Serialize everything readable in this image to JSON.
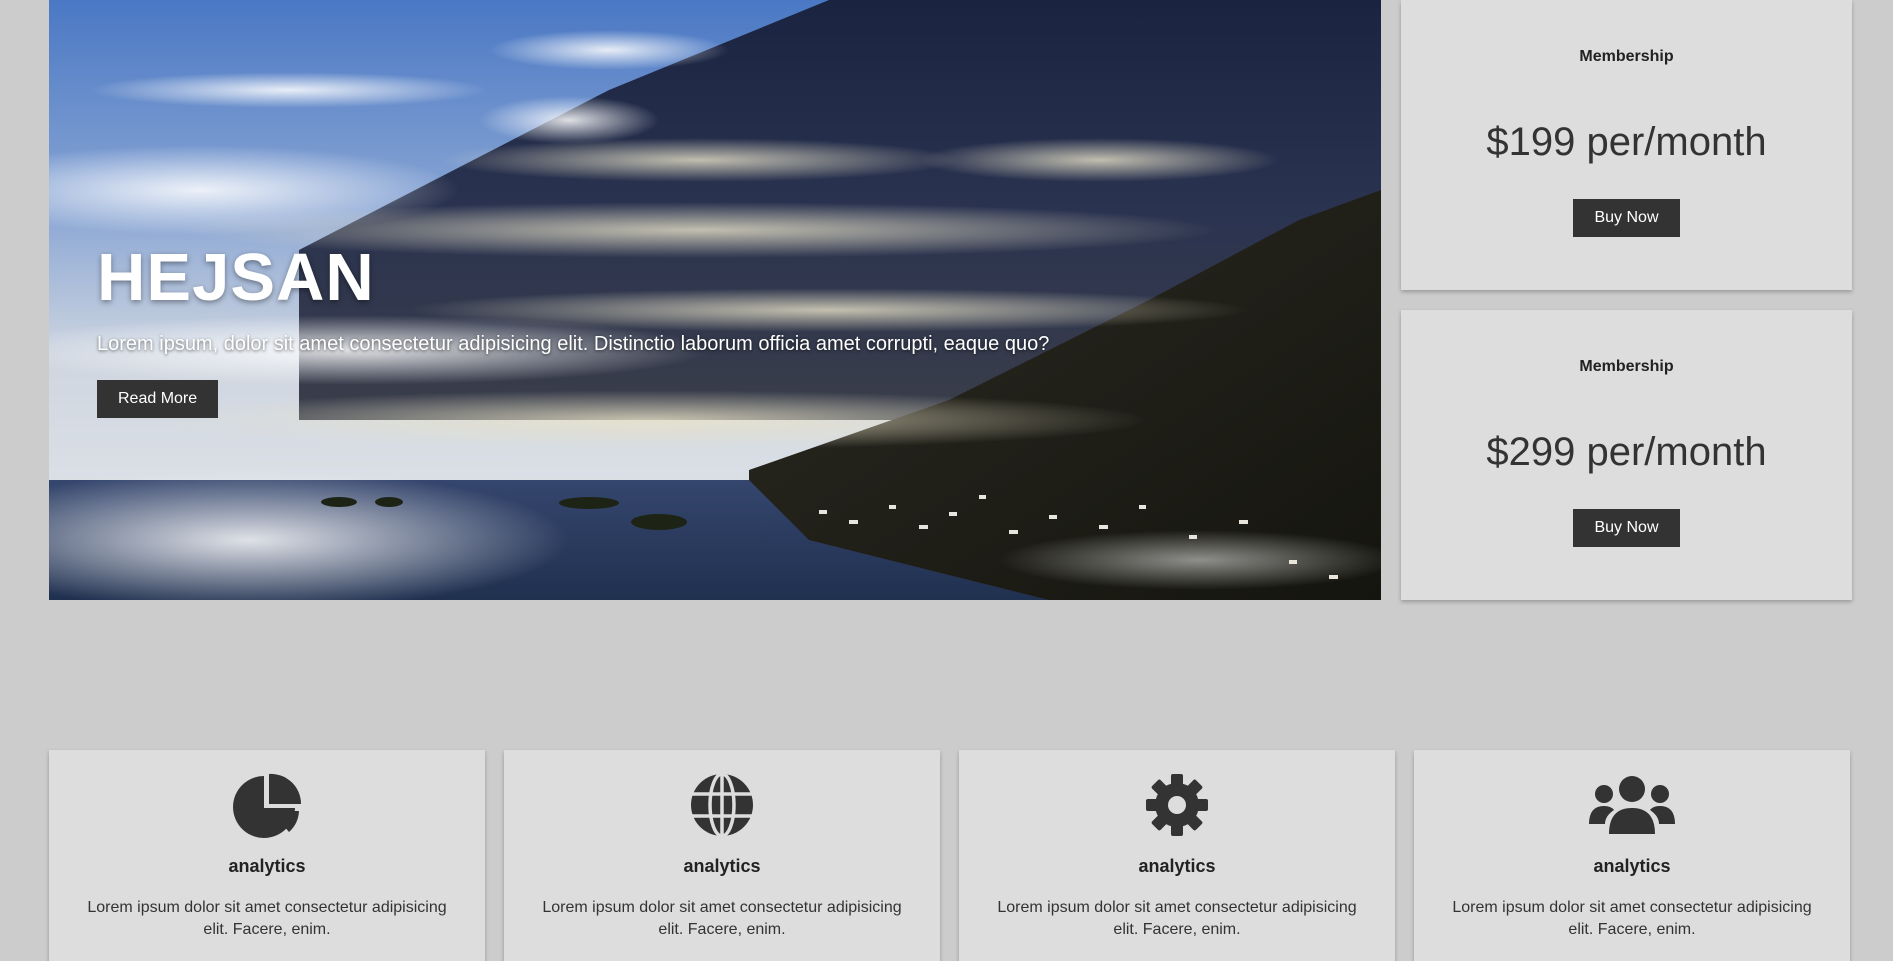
{
  "hero": {
    "title": "HEJSAN",
    "text": "Lorem ipsum, dolor sit amet consectetur adipisicing elit. Distinctio laborum officia amet corrupti, eaque quo?",
    "button": "Read More"
  },
  "plans": [
    {
      "title": "Membership",
      "price": "$199 per/month",
      "button": "Buy Now"
    },
    {
      "title": "Membership",
      "price": "$299 per/month",
      "button": "Buy Now"
    }
  ],
  "features": [
    {
      "icon": "chart-pie-icon",
      "title": "analytics",
      "text": "Lorem ipsum dolor sit amet consectetur adipisicing elit. Facere, enim."
    },
    {
      "icon": "globe-icon",
      "title": "analytics",
      "text": "Lorem ipsum dolor sit amet consectetur adipisicing elit. Facere, enim."
    },
    {
      "icon": "gear-icon",
      "title": "analytics",
      "text": "Lorem ipsum dolor sit amet consectetur adipisicing elit. Facere, enim."
    },
    {
      "icon": "users-icon",
      "title": "analytics",
      "text": "Lorem ipsum dolor sit amet consectetur adipisicing elit. Facere, enim."
    }
  ],
  "colors": {
    "background": "#cccccc",
    "card": "#dddddd",
    "button": "#333333",
    "button_text": "#ffffff"
  }
}
